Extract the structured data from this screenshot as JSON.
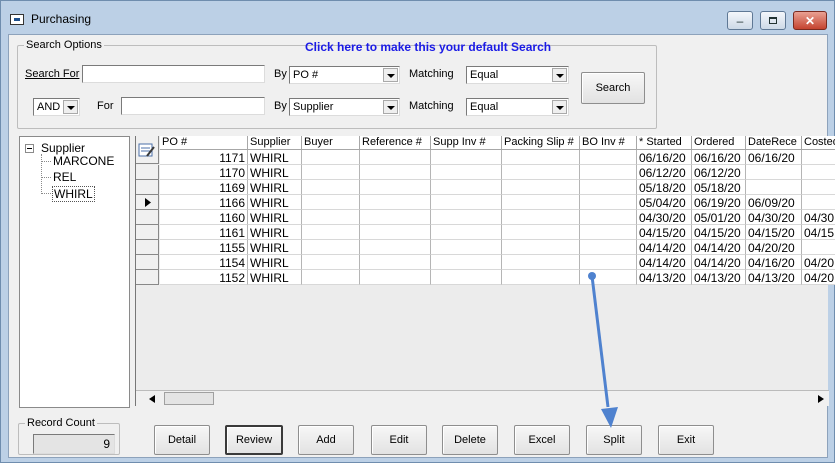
{
  "window": {
    "title": "Purchasing"
  },
  "search_options": {
    "legend": "Search Options",
    "default_link": "Click here to make this your default Search",
    "row1": {
      "label": "Search For",
      "value": "",
      "by_label": "By",
      "by_value": "PO #",
      "matching_label": "Matching",
      "matching_value": "Equal"
    },
    "row2": {
      "logic_value": "AND",
      "label": "For",
      "value": "",
      "by_label": "By",
      "by_value": "Supplier",
      "matching_label": "Matching",
      "matching_value": "Equal"
    },
    "search_button": "Search"
  },
  "tree": {
    "root": "Supplier",
    "children": [
      "MARCONE",
      "REL",
      "WHIRL"
    ],
    "selected": "WHIRL"
  },
  "grid": {
    "columns": [
      "PO #",
      "Supplier",
      "Buyer",
      "Reference #",
      "Supp Inv #",
      "Packing Slip #",
      "BO Inv #",
      "* Started",
      "Ordered",
      "DateRece",
      "Costed"
    ],
    "rows": [
      [
        "1171",
        "WHIRL",
        "",
        "",
        "",
        "",
        "",
        "06/16/20",
        "06/16/20",
        "06/16/20",
        ""
      ],
      [
        "1170",
        "WHIRL",
        "",
        "",
        "",
        "",
        "",
        "06/12/20",
        "06/12/20",
        "",
        ""
      ],
      [
        "1169",
        "WHIRL",
        "",
        "",
        "",
        "",
        "",
        "05/18/20",
        "05/18/20",
        "",
        ""
      ],
      [
        "1166",
        "WHIRL",
        "",
        "",
        "",
        "",
        "",
        "05/04/20",
        "06/19/20",
        "06/09/20",
        ""
      ],
      [
        "1160",
        "WHIRL",
        "",
        "",
        "",
        "",
        "",
        "04/30/20",
        "05/01/20",
        "04/30/20",
        "04/30"
      ],
      [
        "1161",
        "WHIRL",
        "",
        "",
        "",
        "",
        "",
        "04/15/20",
        "04/15/20",
        "04/15/20",
        "04/15"
      ],
      [
        "1155",
        "WHIRL",
        "",
        "",
        "",
        "",
        "",
        "04/14/20",
        "04/14/20",
        "04/20/20",
        ""
      ],
      [
        "1154",
        "WHIRL",
        "",
        "",
        "",
        "",
        "",
        "04/14/20",
        "04/14/20",
        "04/16/20",
        "04/20"
      ],
      [
        "1152",
        "WHIRL",
        "",
        "",
        "",
        "",
        "",
        "04/13/20",
        "04/13/20",
        "04/13/20",
        "04/20"
      ]
    ],
    "current_row": 3
  },
  "record_count": {
    "legend": "Record Count",
    "value": "9"
  },
  "buttons": {
    "detail": "Detail",
    "review": "Review",
    "add": "Add",
    "edit": "Edit",
    "delete": "Delete",
    "excel": "Excel",
    "split": "Split",
    "exit": "Exit"
  },
  "colors": {
    "link": "#1a1ae6",
    "annotation_arrow": "#4f82cf"
  },
  "icons": [
    "app-icon",
    "minimize-icon",
    "maximize-icon",
    "close-icon",
    "edit-grid-icon",
    "row-pointer-icon",
    "chevron-left-icon",
    "chevron-right-icon"
  ]
}
